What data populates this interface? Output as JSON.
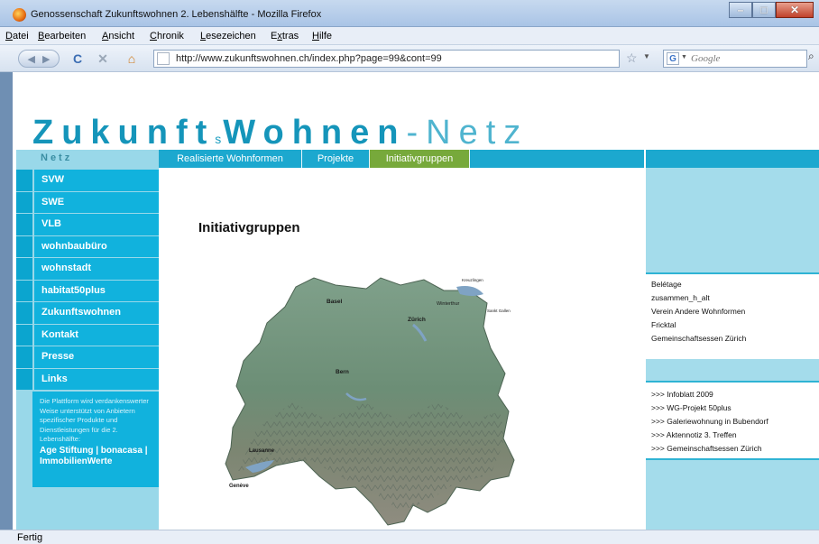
{
  "window": {
    "title": "Genossenschaft Zukunftswohnen 2. Lebenshälfte - Mozilla Firefox",
    "menu": [
      {
        "acc": "D",
        "rest": "atei"
      },
      {
        "acc": "B",
        "rest": "earbeiten"
      },
      {
        "acc": "A",
        "rest": "nsicht"
      },
      {
        "acc": "C",
        "rest": "hronik"
      },
      {
        "acc": "L",
        "rest": "esezeichen"
      },
      {
        "pre": "E",
        "acc": "x",
        "rest": "tras"
      },
      {
        "acc": "H",
        "rest": "ilfe"
      }
    ],
    "url": "http://www.zukunftswohnen.ch/index.php?page=99&cont=99",
    "search_placeholder": "Google",
    "search_engine_icon": "G",
    "status": "Fertig",
    "icons": {
      "back": "◀",
      "forward": "▶",
      "reload": "C",
      "stop": "✕",
      "home": "⌂",
      "star": "☆",
      "go": "⌕"
    }
  },
  "site": {
    "logo": {
      "part1": "Zukunft",
      "part2": "s",
      "part3": "Wohnen",
      "part4": "-",
      "part5": "Netz"
    },
    "net_heading": "Netz",
    "nav": [
      "SVW",
      "SWE",
      "VLB",
      "wohnbaubüro",
      "wohnstadt",
      "habitat50plus",
      "Zukunftswohnen",
      "Kontakt",
      "Presse",
      "Links"
    ],
    "sponsor_text": "Die Plattform wird verdankenswerter Weise unterstützt von Anbietern spezifischer Produkte und Dienstleistungen für die 2. Lebenshälfte:",
    "sponsor_links": "Age Stiftung | bonacasa | ImmobilienWerte",
    "top_tabs": [
      "Realisierte Wohnformen",
      "Projekte",
      "Initiativgruppen"
    ],
    "active_tab": "Initiativgruppen",
    "page_title": "Initiativgruppen",
    "right_links_1": [
      "Belétage",
      "zusammen_h_alt",
      "Verein Andere Wohnformen",
      "Fricktal",
      "Gemeinschaftsessen Zürich"
    ],
    "right_links_2": [
      ">>> Infoblatt 2009",
      ">>> WG-Projekt 50plus",
      ">>> Galeriewohnung in Bubendorf",
      ">>> Aktennotiz 3. Treffen",
      ">>> Gemeinschaftsessen Zürich"
    ],
    "map_labels": [
      "Basel",
      "Zürich",
      "Winterthur",
      "Bern",
      "Lausanne",
      "Genève",
      "Kreuzlingen",
      "Sankt Gallen"
    ]
  },
  "colors": {
    "cyan": "#11b2dd",
    "green": "#77a93b",
    "light_cyan": "#99d8e9"
  }
}
